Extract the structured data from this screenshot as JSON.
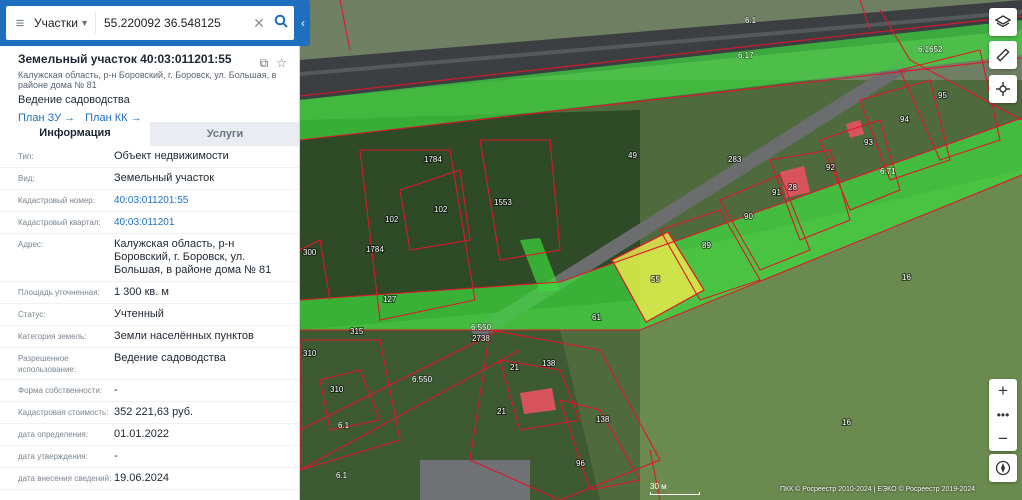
{
  "search": {
    "layer": "Участки",
    "query": "55.220092 36.548125"
  },
  "object": {
    "title": "Земельный участок 40:03:011201:55",
    "address": "Калужская область, р-н Боровский, г. Боровск, ул. Большая, в районе дома № 81",
    "use": "Ведение садоводства",
    "links": [
      "План ЗУ →",
      "План КК →"
    ]
  },
  "tabs": {
    "info": "Информация",
    "services": "Услуги"
  },
  "rows": [
    {
      "k": "Тип:",
      "v": "Объект недвижимости"
    },
    {
      "k": "Вид:",
      "v": "Земельный участок"
    },
    {
      "k": "Кадастровый номер:",
      "v": "40:03:011201:55",
      "link": true
    },
    {
      "k": "Кадастровый квартал:",
      "v": "40:03:011201",
      "link": true
    },
    {
      "k": "Адрес:",
      "v": "Калужская область, р-н Боровский, г. Боровск, ул. Большая, в районе дома № 81"
    },
    {
      "k": "Площадь уточненная:",
      "v": "1 300 кв. м"
    },
    {
      "k": "Статус:",
      "v": "Учтенный"
    },
    {
      "k": "Категория земель:",
      "v": "Земли населённых пунктов"
    },
    {
      "k": "Разрешенное использование:",
      "v": "Ведение садоводства"
    },
    {
      "k": "Форма собственности:",
      "v": "-"
    },
    {
      "k": "Кадастровая стоимость:",
      "v": "352 221,63 руб."
    },
    {
      "k": "дата определения:",
      "v": "01.01.2022"
    },
    {
      "k": "дата утверждения:",
      "v": "-"
    },
    {
      "k": "дата внесения сведений:",
      "v": "19.06.2024"
    }
  ],
  "map": {
    "zone_labels": [
      "6.1",
      "6.17",
      "6.1652",
      "6.71",
      "6.550",
      "6.550",
      "6.1",
      "6.1"
    ],
    "plot_labels": [
      "49",
      "283",
      "1553",
      "102",
      "102",
      "1784",
      "1784",
      "300",
      "89",
      "90",
      "91",
      "92",
      "93",
      "94",
      "95",
      "16",
      "16",
      "55",
      "61",
      "127",
      "315",
      "310",
      "310",
      "2738",
      "138",
      "138",
      "21",
      "21",
      "96",
      "28"
    ],
    "scale": "30 м",
    "attribution": "ПКК © Росреестр 2010-2024 | ЕЭКО © Росреестр 2019-2024",
    "colors": {
      "zone_green": "#3fd93f",
      "selected_plot": "#e5e84a",
      "boundary": "#e0162b"
    }
  }
}
